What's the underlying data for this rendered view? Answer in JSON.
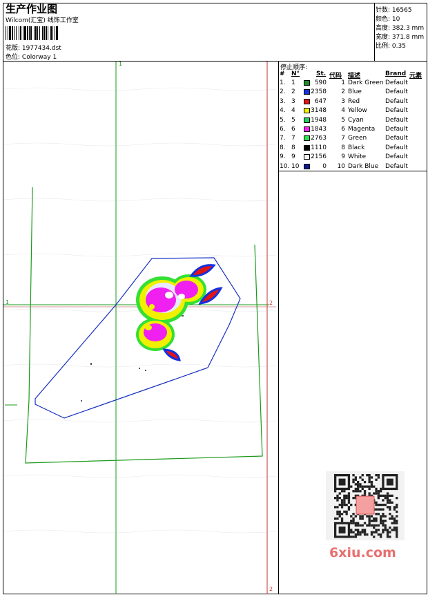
{
  "header": {
    "title": "生产作业图",
    "company": "Wilcom(汇宝) 线饰工作室",
    "pattern_label": "花版:",
    "pattern_value": "1977434.dst",
    "colorway_label": "色位:",
    "colorway_value": "Colorway 1"
  },
  "stats": [
    {
      "label": "针数:",
      "value": "16565"
    },
    {
      "label": "颜色:",
      "value": "10"
    },
    {
      "label": "高度:",
      "value": "382.3 mm"
    },
    {
      "label": "宽度:",
      "value": "371.8 mm"
    },
    {
      "label": "比例:",
      "value": "0.35"
    }
  ],
  "sequence": {
    "title": "停止顺序:",
    "headers": {
      "idx": "#",
      "no": "N°",
      "st": "St.",
      "code": "代码",
      "desc": "描述",
      "brand": "Brand",
      "elem": "元素"
    },
    "rows": [
      {
        "idx": "1.",
        "no": "1",
        "color": "#1f8a2a",
        "st": "590",
        "code": "1",
        "desc": "Dark Green",
        "brand": "Default"
      },
      {
        "idx": "2.",
        "no": "2",
        "color": "#1530e0",
        "st": "2358",
        "code": "2",
        "desc": "Blue",
        "brand": "Default"
      },
      {
        "idx": "3.",
        "no": "3",
        "color": "#e01515",
        "st": "647",
        "code": "3",
        "desc": "Red",
        "brand": "Default"
      },
      {
        "idx": "4.",
        "no": "4",
        "color": "#f0f000",
        "st": "3148",
        "code": "4",
        "desc": "Yellow",
        "brand": "Default"
      },
      {
        "idx": "5.",
        "no": "5",
        "color": "#20d060",
        "st": "1948",
        "code": "5",
        "desc": "Cyan",
        "brand": "Default"
      },
      {
        "idx": "6.",
        "no": "6",
        "color": "#f020f0",
        "st": "1843",
        "code": "6",
        "desc": "Magenta",
        "brand": "Default"
      },
      {
        "idx": "7.",
        "no": "7",
        "color": "#30e050",
        "st": "2763",
        "code": "7",
        "desc": "Green",
        "brand": "Default"
      },
      {
        "idx": "8.",
        "no": "8",
        "color": "#000000",
        "st": "1110",
        "code": "8",
        "desc": "Black",
        "brand": "Default"
      },
      {
        "idx": "9.",
        "no": "9",
        "color": "#f4f4f4",
        "st": "2156",
        "code": "9",
        "desc": "White",
        "brand": "Default"
      },
      {
        "idx": "10.",
        "no": "10",
        "color": "#101a90",
        "st": "0",
        "code": "10",
        "desc": "Dark Blue",
        "brand": "Default"
      }
    ]
  },
  "markers": {
    "one": "1",
    "two": "2"
  },
  "watermark": "6xiu.com"
}
